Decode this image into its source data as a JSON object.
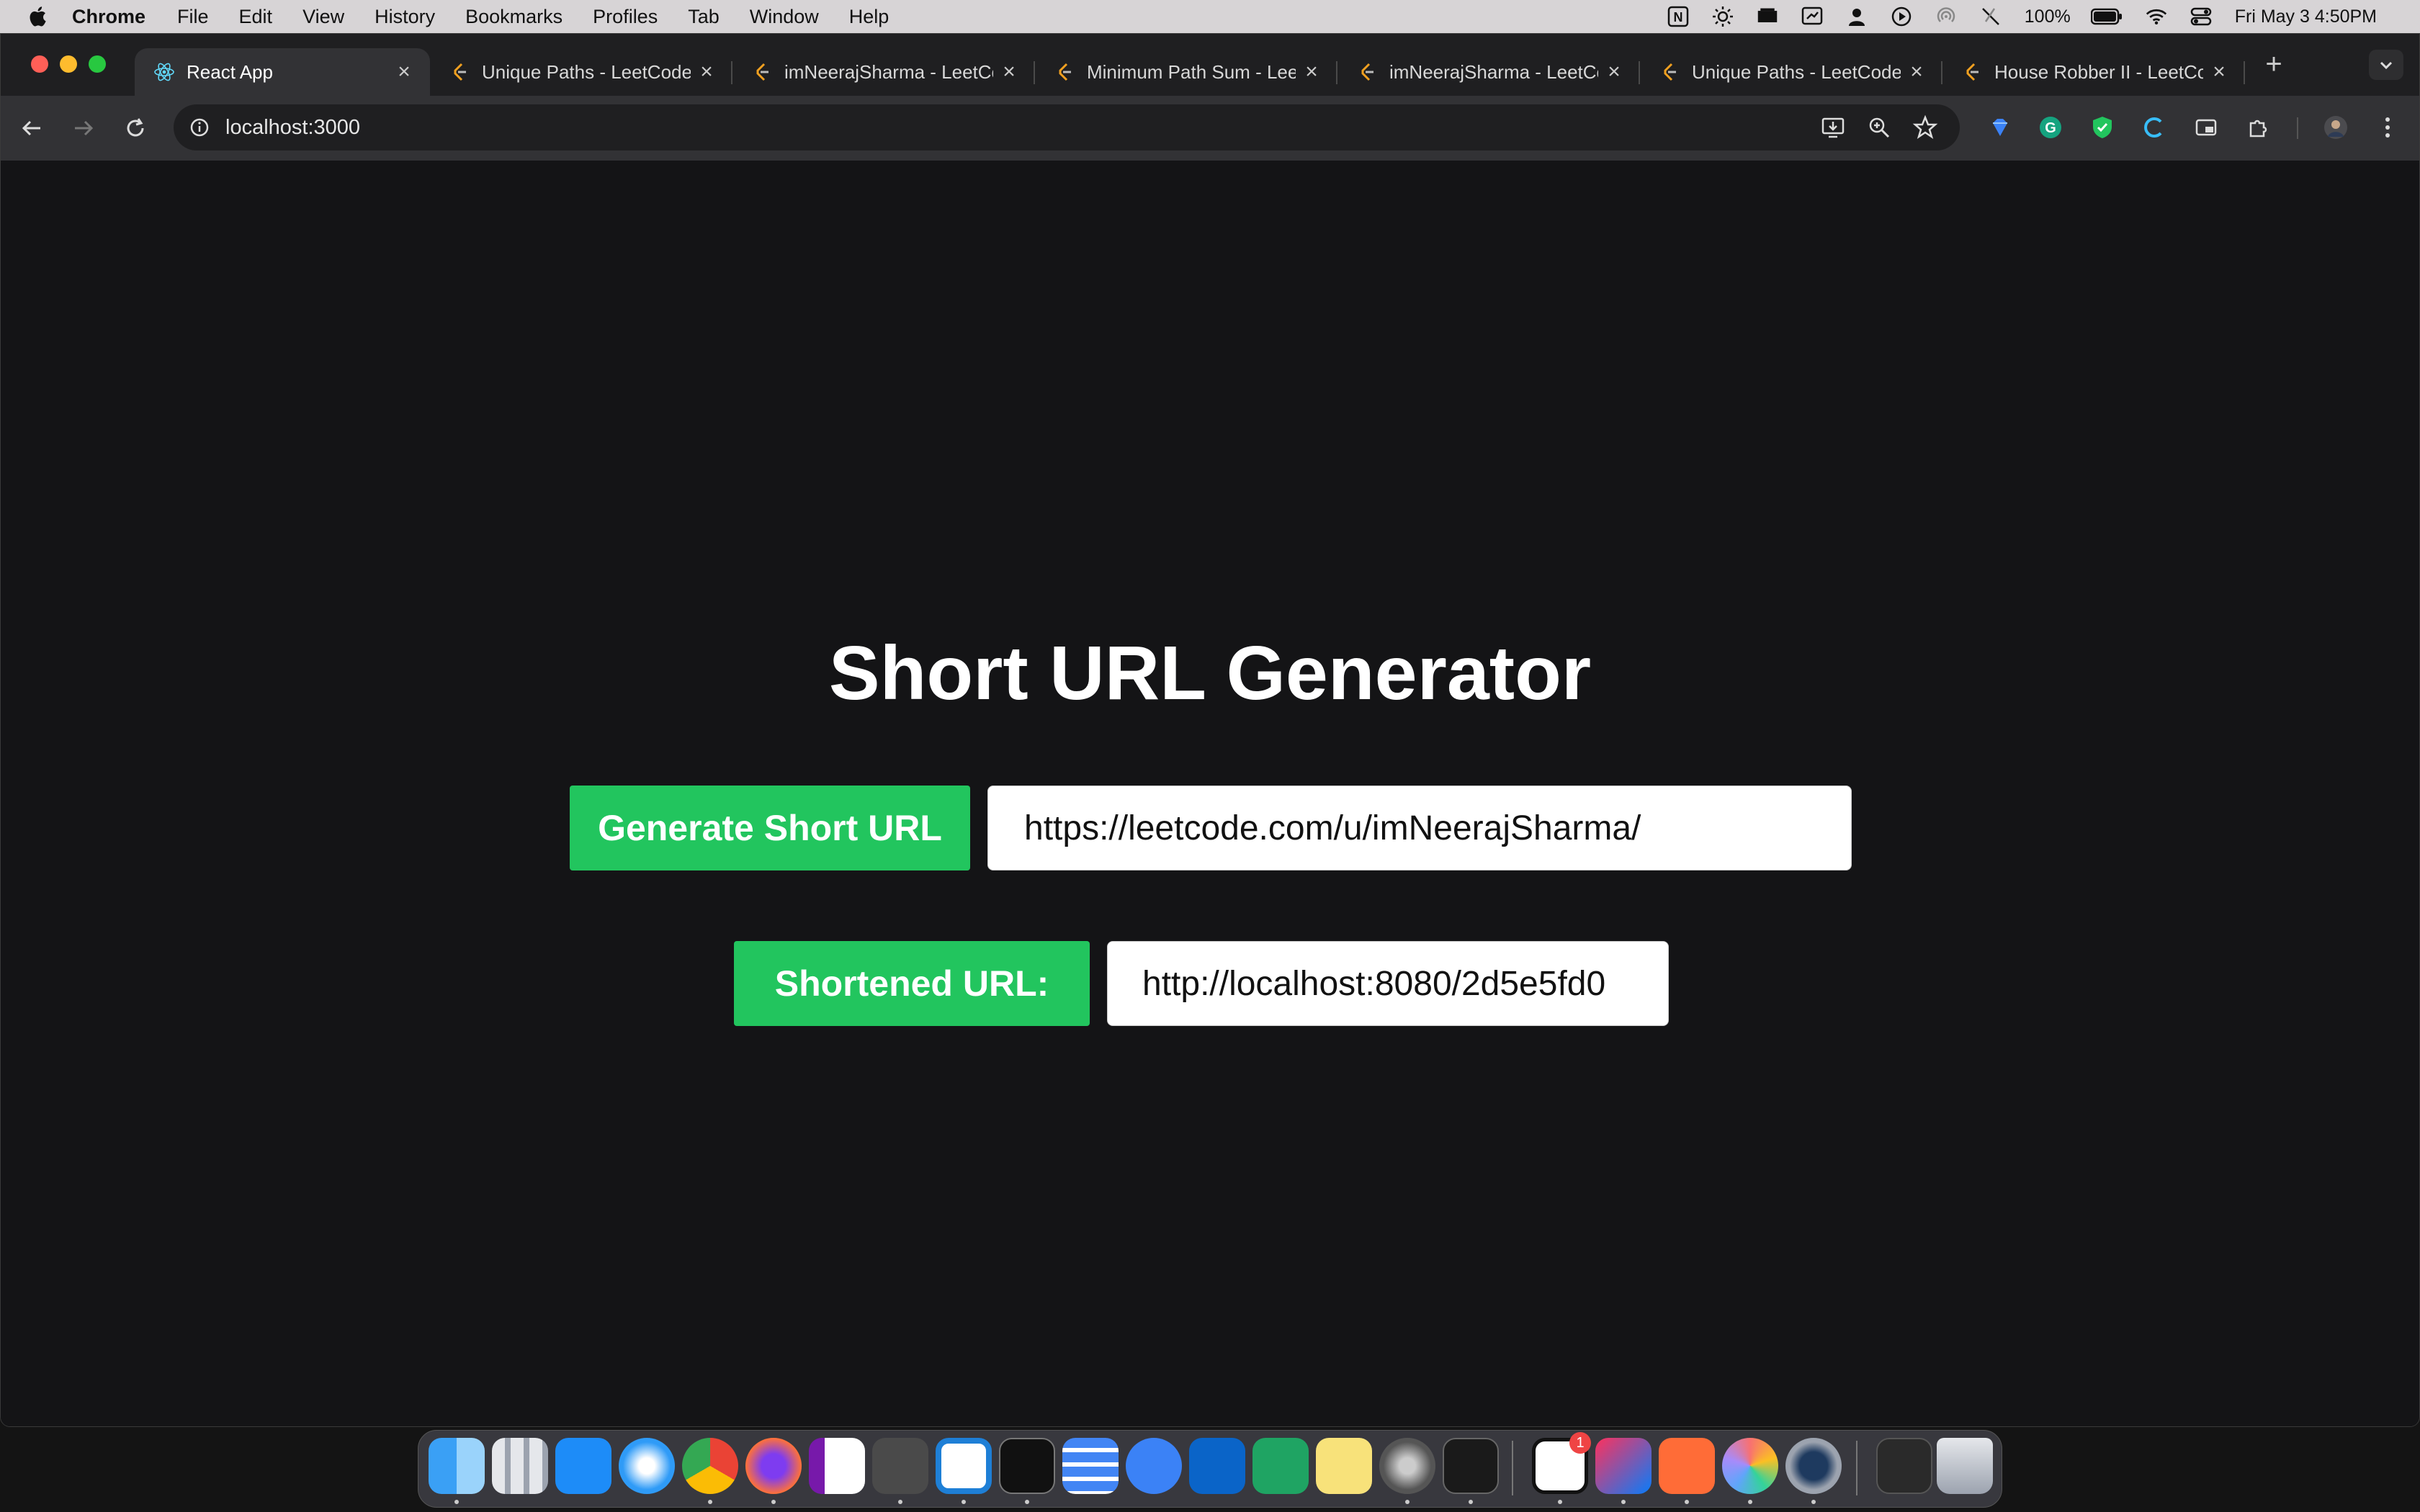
{
  "menubar": {
    "app_name": "Chrome",
    "items": [
      "File",
      "Edit",
      "View",
      "History",
      "Bookmarks",
      "Profiles",
      "Tab",
      "Window",
      "Help"
    ],
    "battery": "100%",
    "clock": "Fri May 3  4:50PM"
  },
  "browser": {
    "tabs": [
      {
        "title": "React App",
        "icon": "react-icon",
        "active": true
      },
      {
        "title": "Unique Paths - LeetCode",
        "icon": "leetcode-icon",
        "active": false
      },
      {
        "title": "imNeerajSharma - LeetCode",
        "icon": "leetcode-icon",
        "active": false
      },
      {
        "title": "Minimum Path Sum - LeetCode",
        "icon": "leetcode-icon",
        "active": false
      },
      {
        "title": "imNeerajSharma - LeetCode",
        "icon": "leetcode-icon",
        "active": false
      },
      {
        "title": "Unique Paths - LeetCode",
        "icon": "leetcode-icon",
        "active": false
      },
      {
        "title": "House Robber II - LeetCode",
        "icon": "leetcode-icon",
        "active": false
      }
    ],
    "address": "localhost:3000"
  },
  "page": {
    "title": "Short URL Generator",
    "generate_button_label": "Generate Short URL",
    "long_url_value": "https://leetcode.com/u/imNeerajSharma/",
    "shortened_label": "Shortened URL:",
    "short_url_value": "http://localhost:8080/2d5e5fd0"
  },
  "dock": {
    "notion_badge": "1",
    "apps": [
      "finder-icon",
      "launchpad-icon",
      "app-store-icon",
      "safari-icon",
      "chrome-icon",
      "firefox-icon",
      "onenote-icon",
      "sublime-text-icon",
      "vscode-icon",
      "terminal-icon",
      "google-docs-icon",
      "icloud-icon",
      "outlook-icon",
      "google-sheets-icon",
      "stickies-icon",
      "disk-utility-icon",
      "activity-monitor-icon",
      "notion-icon",
      "intellij-icon",
      "postman-icon",
      "photos-icon",
      "quicktime-icon",
      "downloads-icon",
      "trash-icon"
    ]
  },
  "colors": {
    "accent_green": "#22c55e",
    "page_background": "#141416"
  }
}
